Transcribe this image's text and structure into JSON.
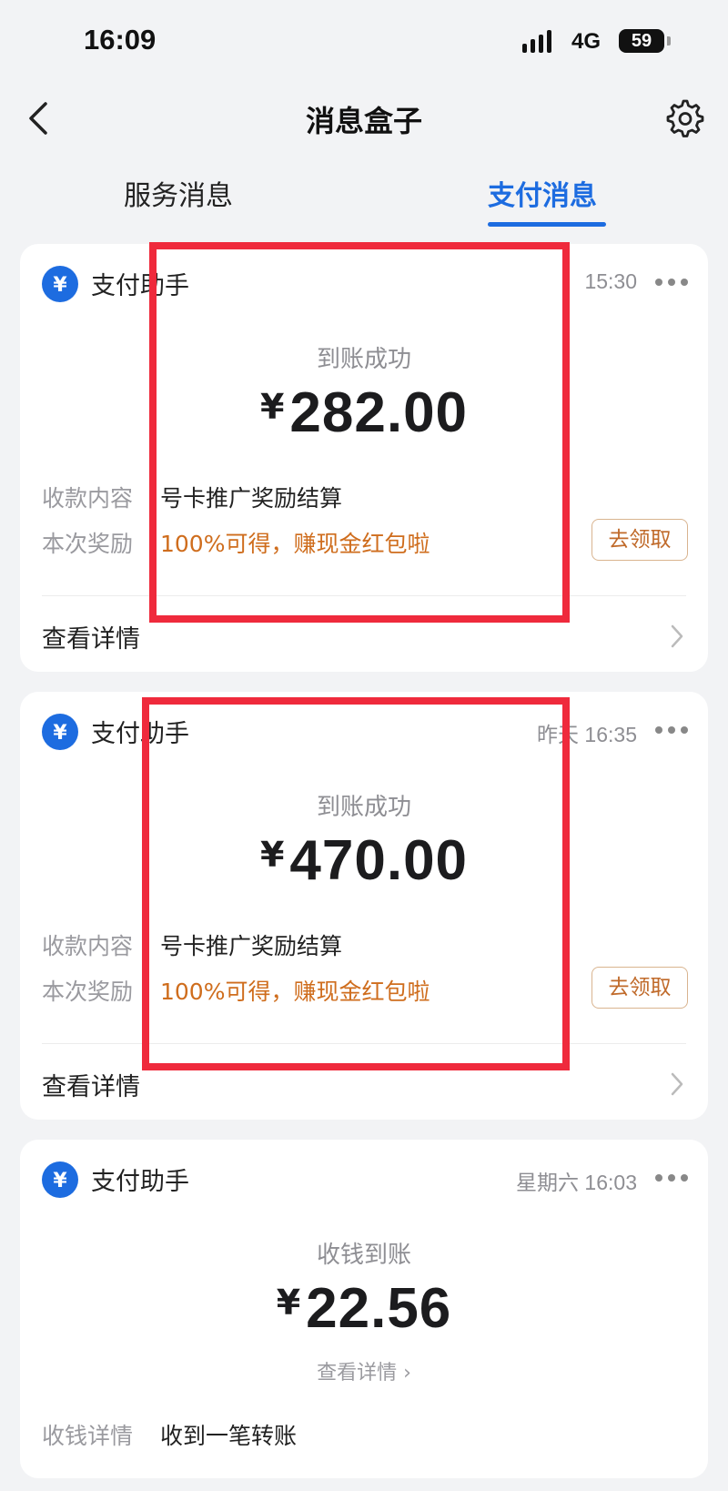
{
  "status_bar": {
    "time": "16:09",
    "network": "4G",
    "battery": "59"
  },
  "nav": {
    "title": "消息盒子"
  },
  "tabs": [
    {
      "label": "服务消息",
      "active": false
    },
    {
      "label": "支付消息",
      "active": true
    }
  ],
  "colors": {
    "accent": "#1d6ce0",
    "reward": "#cf6d1d",
    "highlight": "#ef2a3c"
  },
  "messages": [
    {
      "sender": "支付助手",
      "time": "15:30",
      "label": "到账成功",
      "currency": "¥",
      "amount": "282.00",
      "content_label": "收款内容",
      "content_value": "号卡推广奖励结算",
      "reward_label": "本次奖励",
      "reward_value": "100%可得，赚现金红包啦",
      "claim_label": "去领取",
      "view_detail": "查看详情"
    },
    {
      "sender": "支付助手",
      "time": "昨天 16:35",
      "label": "到账成功",
      "currency": "¥",
      "amount": "470.00",
      "content_label": "收款内容",
      "content_value": "号卡推广奖励结算",
      "reward_label": "本次奖励",
      "reward_value": "100%可得，赚现金红包啦",
      "claim_label": "去领取",
      "view_detail": "查看详情"
    },
    {
      "sender": "支付助手",
      "time": "星期六 16:03",
      "label": "收钱到账",
      "currency": "¥",
      "amount": "22.56",
      "view_detail_link": "查看详情 ›",
      "detail_label": "收钱详情",
      "detail_value": "收到一笔转账"
    }
  ]
}
